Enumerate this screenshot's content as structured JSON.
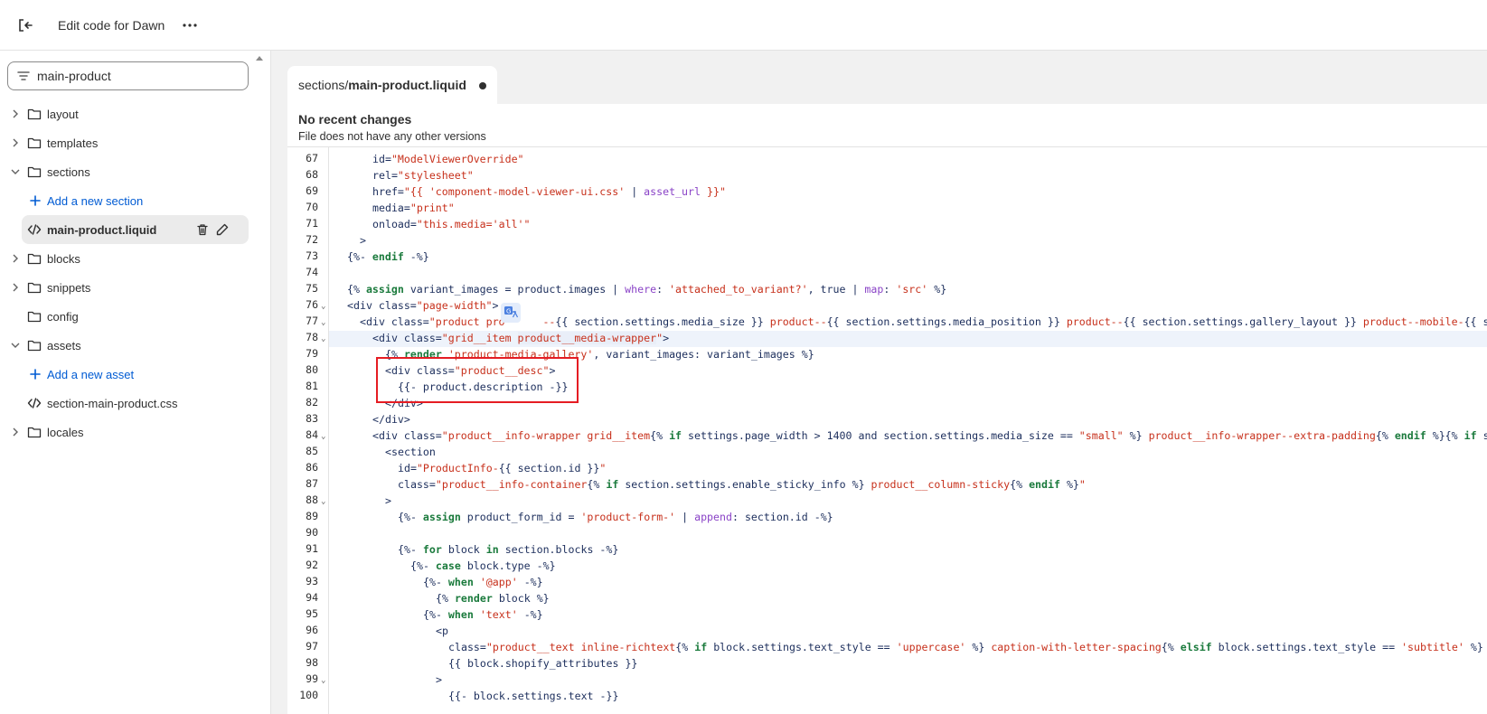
{
  "header": {
    "title": "Edit code for Dawn",
    "exit_icon": "exit-icon",
    "more_icon": "more-horizontal-icon"
  },
  "sidebar": {
    "search_value": "main-product",
    "items": [
      {
        "label": "layout",
        "kind": "folder",
        "expanded": false
      },
      {
        "label": "templates",
        "kind": "folder",
        "expanded": false
      },
      {
        "label": "sections",
        "kind": "folder",
        "expanded": true
      },
      {
        "label": "Add a new section",
        "kind": "add"
      },
      {
        "label": "main-product.liquid",
        "kind": "file",
        "selected": true
      },
      {
        "label": "blocks",
        "kind": "folder",
        "expanded": false
      },
      {
        "label": "snippets",
        "kind": "folder",
        "expanded": false
      },
      {
        "label": "config",
        "kind": "folder-noarrow"
      },
      {
        "label": "assets",
        "kind": "folder",
        "expanded": true
      },
      {
        "label": "Add a new asset",
        "kind": "add"
      },
      {
        "label": "section-main-product.css",
        "kind": "file-leaf"
      },
      {
        "label": "locales",
        "kind": "folder",
        "expanded": false
      }
    ]
  },
  "tab": {
    "path": "sections/",
    "filename": "main-product.liquid"
  },
  "versions": {
    "heading": "No recent changes",
    "subtext": "File does not have any other versions"
  },
  "editor": {
    "line_numbers": [
      "67",
      "68",
      "69",
      "70",
      "71",
      "72",
      "73",
      "74",
      "75",
      "76",
      "77",
      "78",
      "79",
      "80",
      "81",
      "82",
      "83",
      "84",
      "85",
      "86",
      "87",
      "88",
      "89",
      "90",
      "91",
      "92",
      "93",
      "94",
      "95",
      "96",
      "97",
      "98",
      "99",
      "100"
    ],
    "active_line": "78",
    "fold_lines": [
      "76",
      "77",
      "78",
      "84",
      "88",
      "99"
    ]
  },
  "colors": {
    "accent": "#005bd3",
    "highlight_box": "#e51c23",
    "string": "#c7301b",
    "keyword": "#1a7a3c",
    "filter": "#8a43c7"
  }
}
